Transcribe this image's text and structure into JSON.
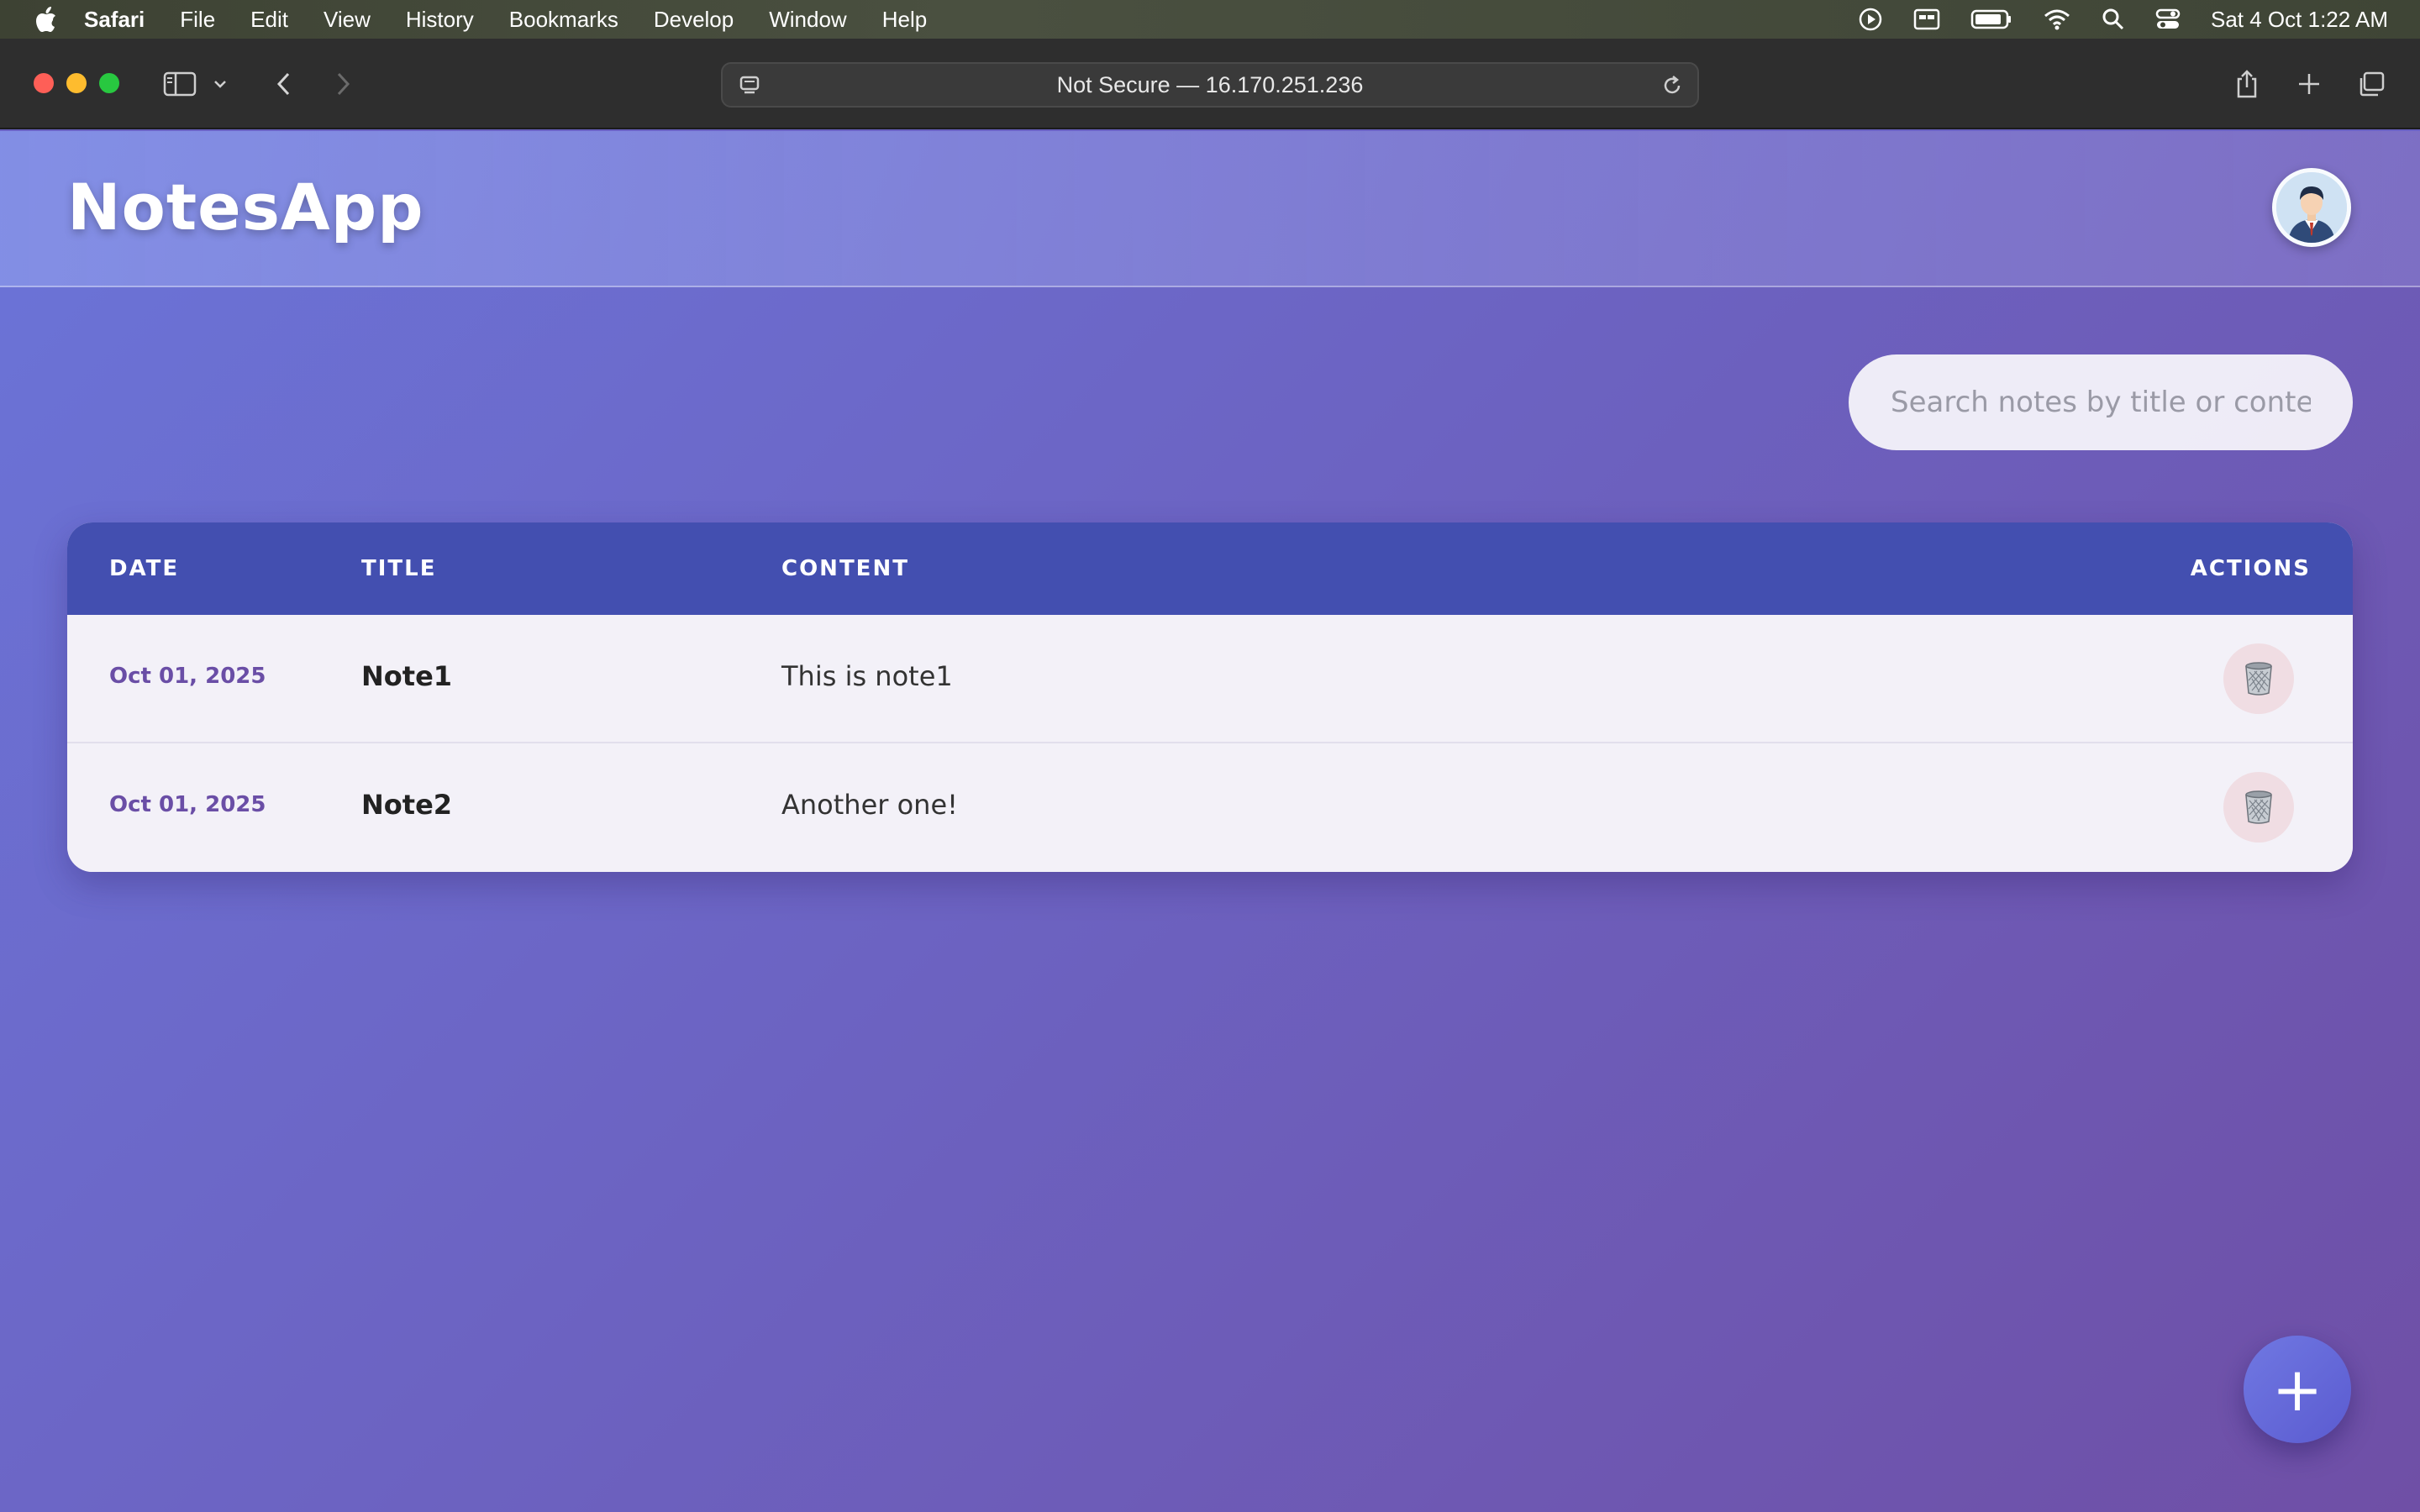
{
  "menubar": {
    "app_name": "Safari",
    "items": [
      "File",
      "Edit",
      "View",
      "History",
      "Bookmarks",
      "Develop",
      "Window",
      "Help"
    ],
    "clock": "Sat 4 Oct  1:22 AM",
    "status_icons": [
      "play-icon",
      "display-icon",
      "battery-icon",
      "wifi-icon",
      "search-icon",
      "control-center-icon"
    ]
  },
  "browser": {
    "address": "Not Secure — 16.170.251.236"
  },
  "app": {
    "logo": "NotesApp",
    "search_placeholder": "Search notes by title or content",
    "accent_color": "#434fb0",
    "table": {
      "headers": [
        "DATE",
        "TITLE",
        "CONTENT",
        "ACTIONS"
      ],
      "rows": [
        {
          "date": "Oct 01, 2025",
          "title": "Note1",
          "content": "This is note1"
        },
        {
          "date": "Oct 01, 2025",
          "title": "Note2",
          "content": "Another one!"
        }
      ]
    },
    "fab_label": "+"
  }
}
